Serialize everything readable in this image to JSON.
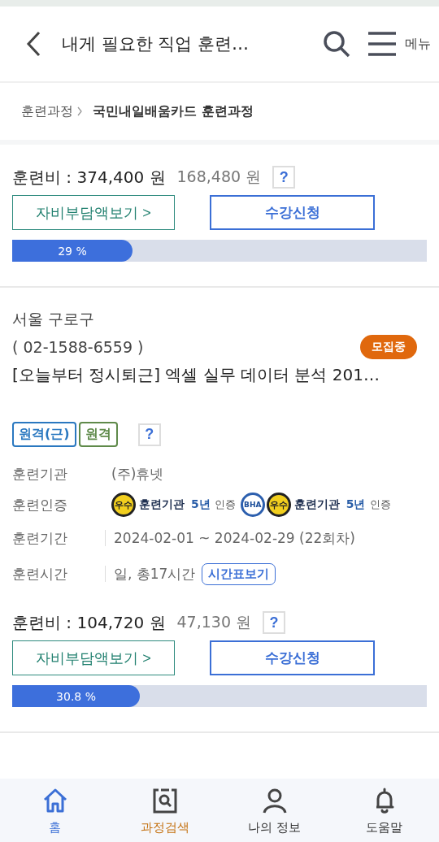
{
  "header": {
    "title": "내게 필요한 직업 훈련…",
    "menu_label": "메뉴"
  },
  "breadcrumb": [
    {
      "label": "훈련과정"
    },
    {
      "label": "국민내일배움카드 훈련과정"
    }
  ],
  "courses": [
    {
      "kind": "fee_only",
      "price": "훈련비 : 374,400 원",
      "self_pay": "168,480 원",
      "help": "?",
      "copay_button": "자비부담액보기 >",
      "apply_button": "수강신청",
      "progress": {
        "level": 0.29,
        "reading": "29 %"
      }
    },
    {
      "kind": "full",
      "location": "서울 구로구",
      "phone": "( 02-1588-6559 )",
      "status": "모집중",
      "title": "[오늘부터 정시퇴근] 엑셀 실무 데이터 분석 201…",
      "tags": [
        {
          "label": "원격(근)",
          "color": "#2a78c0"
        },
        {
          "label": "원격",
          "color": "#5f8a4a"
        }
      ],
      "tags_help": "?",
      "info": [
        {
          "kind": "text",
          "label": "훈련기관",
          "value": "(주)휴넷",
          "divider": false
        },
        {
          "kind": "certs",
          "label": "훈련인증",
          "divider": false,
          "certs": [
            {
              "kind": "award",
              "seal": "우수",
              "name": "훈련기관",
              "years": "5년",
              "suffix": "인증"
            },
            {
              "kind": "bha",
              "seal": "BHA"
            },
            {
              "kind": "award",
              "seal": "우수",
              "name": "훈련기관",
              "years": "5년",
              "suffix": "인증"
            }
          ]
        },
        {
          "kind": "text",
          "label": "훈련기간",
          "value": "2024-02-01 ~ 2024-02-29 (22회차)",
          "divider": true
        },
        {
          "kind": "schedule",
          "label": "훈련시간",
          "value": "일, 총17시간",
          "button": "시간표보기",
          "divider": true
        }
      ],
      "price": "훈련비 : 104,720 원",
      "self_pay": "47,130 원",
      "help": "?",
      "copay_button": "자비부담액보기 >",
      "apply_button": "수강신청",
      "progress": {
        "level": 0.308,
        "reading": "30.8 %"
      }
    }
  ],
  "nav": [
    {
      "kind": "home",
      "label": "홈",
      "color": "#3b6fd6"
    },
    {
      "kind": "search",
      "label": "과정검색",
      "color": "#c4700f"
    },
    {
      "kind": "person",
      "label": "나의 정보",
      "color": "#333333"
    },
    {
      "kind": "bell",
      "label": "도움말",
      "color": "#333333"
    }
  ]
}
